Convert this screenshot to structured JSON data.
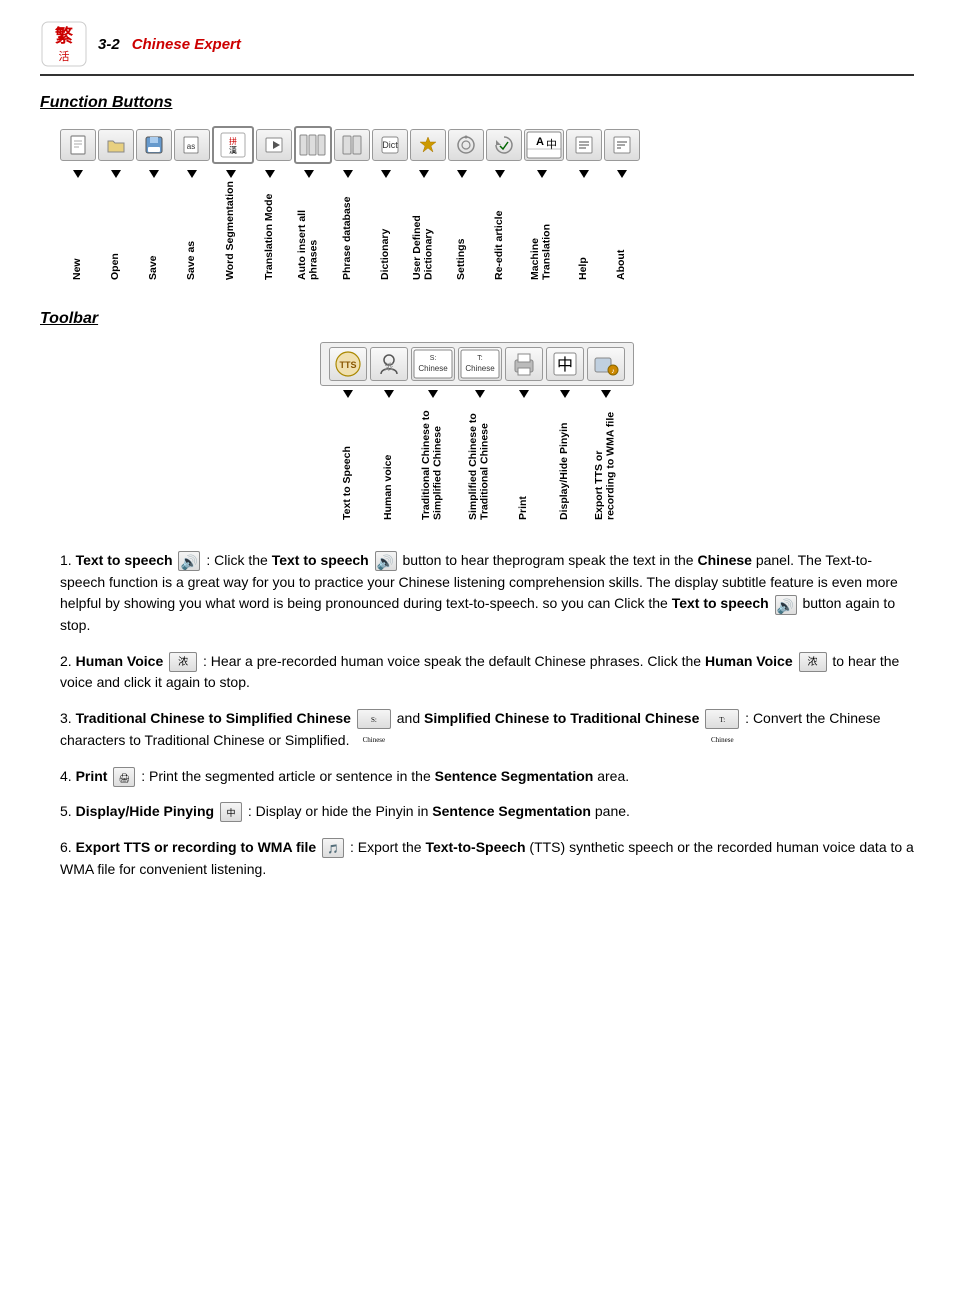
{
  "header": {
    "page_num": "3-2",
    "app_name": "Chinese Expert"
  },
  "function_buttons_section": {
    "title": "Function Buttons",
    "buttons": [
      {
        "label": "New",
        "icon": "🗋"
      },
      {
        "label": "Open",
        "icon": "📂"
      },
      {
        "label": "Save",
        "icon": "💾"
      },
      {
        "label": "Save as",
        "icon": "📋"
      },
      {
        "label": "Word Segmentation",
        "icon": "拼漢"
      },
      {
        "label": "Translation Mode",
        "icon": "➤"
      },
      {
        "label": "Auto insert all phrases",
        "icon": "▌▌▌"
      },
      {
        "label": "Phrase database",
        "icon": "▌▌"
      },
      {
        "label": "Dictionary",
        "icon": "Dict"
      },
      {
        "label": "User Defined Dictionary",
        "icon": "★"
      },
      {
        "label": "Settings",
        "icon": "🔍"
      },
      {
        "label": "Re-edit article",
        "icon": "✓"
      },
      {
        "label": "Machine Translation",
        "icon": "A中"
      },
      {
        "label": "Help",
        "icon": "≡"
      },
      {
        "label": "About",
        "icon": "≡"
      }
    ]
  },
  "toolbar_section": {
    "title": "Toolbar",
    "buttons": [
      {
        "label": "Text to Speech",
        "icon": "TTS"
      },
      {
        "label": "Human voice",
        "icon": "浓"
      },
      {
        "label": "Traditional Chinese to Simplified Chinese",
        "icon": "S:Chinese"
      },
      {
        "label": "Simplified Chinese to Traditional Chinese",
        "icon": "T:Chinese"
      },
      {
        "label": "Print",
        "icon": "🖨"
      },
      {
        "label": "Display/Hide Pinyin",
        "icon": "中"
      },
      {
        "label": "Export TTS or recording to WMA file",
        "icon": "🎵"
      }
    ]
  },
  "list_items": [
    {
      "num": "1",
      "bold_start": "Text to speech",
      "text1": ": Click the ",
      "bold2": "Text to speech",
      "text2": " button to hear theprogram speak the text in the ",
      "bold3": "Chinese",
      "text3": " panel. The Text-to-speech function is a great way for you to practice your Chinese listening comprehension skills. The display subtitle feature is even more helpful by showing you what word is being pronounced during text-to-speech. so you can Click the ",
      "bold4": "Text to speech",
      "text4": " button again to stop."
    },
    {
      "num": "2",
      "bold_start": "Human Voice",
      "text1": ": Hear a pre-recorded human voice speak the default Chinese phrases. Click the ",
      "bold2": "Human Voice",
      "text2": " to hear the voice and click it again to stop."
    },
    {
      "num": "3",
      "bold_start": "Traditional Chinese to Simplified Chinese",
      "text1": " and ",
      "bold2": "Simplified Chinese to Traditional Chinese",
      "text2": ": Convert the Chinese characters to Traditional Chinese or Simplified."
    },
    {
      "num": "4",
      "bold_start": "Print",
      "text1": ": Print the segmented article or sentence in the ",
      "bold2": "Sentence Segmentation",
      "text2": " area."
    },
    {
      "num": "5",
      "bold_start": "Display/Hide Pinying",
      "text1": ": Display or hide the Pinyin in ",
      "bold2": "Sentence Segmentation",
      "text2": " pane."
    },
    {
      "num": "6",
      "bold_start": "Export TTS or recording to WMA file",
      "text1": ": Export the ",
      "bold2": "Text-to-Speech",
      "text2": " (TTS) synthetic speech or the recorded human voice data to a WMA file for convenient listening."
    }
  ]
}
